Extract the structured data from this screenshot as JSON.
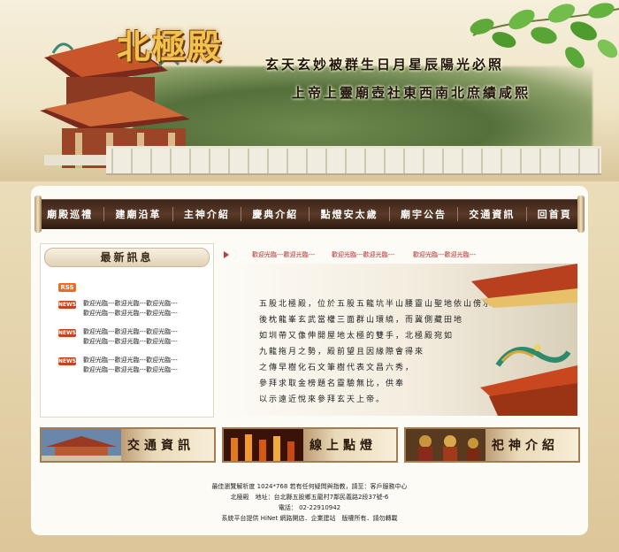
{
  "header": {
    "title": "北極殿",
    "couplet_1": "玄天玄妙被群生日月星辰陽光必照",
    "couplet_2": "上帝上靈廟壺社東西南北庶績咸熙"
  },
  "nav": {
    "items": [
      "廟殿巡禮",
      "建廟沿革",
      "主神介紹",
      "慶典介紹",
      "點燈安太歲",
      "廟宇公告",
      "交通資訊",
      "回首頁"
    ]
  },
  "news": {
    "heading": "最新訊息",
    "rss_label": "RSS",
    "badge_label": "NEWS",
    "items": [
      {
        "line1": "歡迎光臨---歡迎光臨---歡迎光臨---",
        "line2": "歡迎光臨---歡迎光臨---歡迎光臨---"
      },
      {
        "line1": "歡迎光臨---歡迎光臨---歡迎光臨---",
        "line2": "歡迎光臨---歡迎光臨---歡迎光臨---"
      },
      {
        "line1": "歡迎光臨---歡迎光臨---歡迎光臨---",
        "line2": "歡迎光臨---歡迎光臨---歡迎光臨---"
      }
    ]
  },
  "marquee": {
    "links": [
      "歡迎光臨---歡迎光臨---",
      "歡迎光臨---歡迎光臨---",
      "歡迎光臨---歡迎光臨---"
    ]
  },
  "intro": {
    "lines": [
      "五股北極殿，位於五股五龍坑半山腰靈山聖地依山傍水，",
      "後枕龍峯玄武當權三面群山環繞，而冀側藏田地",
      "如圳帶又像伸開屋地太極的雙手，北極殿宛如",
      "九龍拖月之勢，殿前望且因緣際會得來",
      "之傳早樹化石文筆樹代表文昌六秀，",
      "參拜求取金榜題名靈驗無比，供奉",
      "以示遠近悅來參拜玄天上帝。"
    ]
  },
  "features": {
    "traffic": "交通資訊",
    "lamp": "線上點燈",
    "deity": "祀神介紹"
  },
  "footer": {
    "line1": "最佳瀏覽解析度 1024*768 若有任何疑問與指教，請至：客戶服務中心",
    "line2": "北極殿　地址：台北縣五股鄉五龍村7鄰民義路2段37號-6",
    "line3": "電話： 02-22910942",
    "line4": "系統平台提供 HiNet 網路開店．企業建站　版權所有．請勿轉載"
  }
}
